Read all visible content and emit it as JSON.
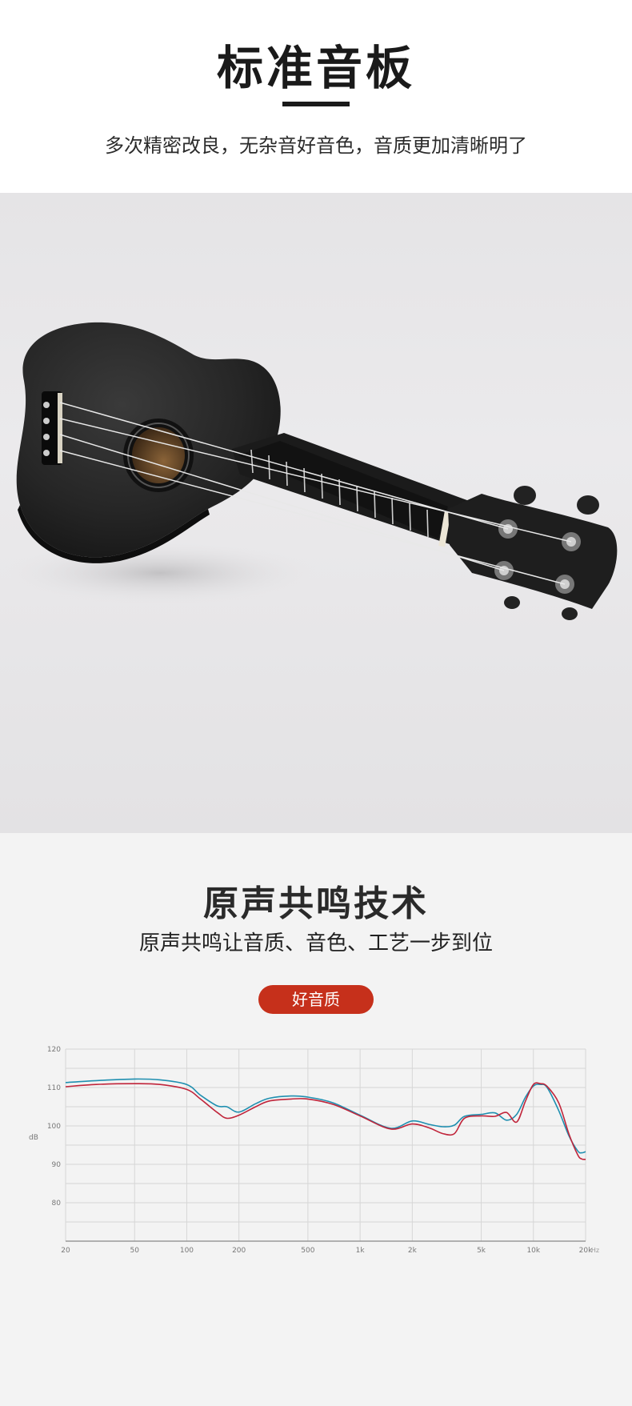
{
  "header": {
    "title": "标准音板",
    "subtitle": "多次精密改良，无杂音好音色，音质更加清晰明了"
  },
  "section2": {
    "title": "原声共鸣技术",
    "subtitle": "原声共鸣让音质、音色、工艺一步到位",
    "badge": "好音质"
  },
  "colors": {
    "accent": "#c6301b",
    "series_blue": "#1f8fb0",
    "series_red": "#c0243a",
    "grid": "#d6d6d6"
  },
  "chart_data": {
    "type": "line",
    "xscale": "log",
    "xlim": [
      20,
      20000
    ],
    "ylim": [
      70,
      120
    ],
    "grid": true,
    "xunit": "Hz",
    "ylabel": "dB",
    "y_ticks": [
      120,
      110,
      100,
      90,
      80
    ],
    "y_tick_labels": [
      "120",
      "110",
      "100",
      "90",
      "80"
    ],
    "x_ticks": [
      20,
      50,
      100,
      200,
      500,
      1000,
      2000,
      5000,
      10000,
      20000
    ],
    "x_tick_labels": [
      "20",
      "50",
      "100",
      "200",
      "500",
      "1k",
      "2k",
      "5k",
      "10k",
      "20k"
    ],
    "series": [
      {
        "points": [
          [
            20,
            111.3
          ],
          [
            30,
            111.8
          ],
          [
            50,
            112.2
          ],
          [
            70,
            112
          ],
          [
            100,
            110.8
          ],
          [
            120,
            108
          ],
          [
            150,
            105.2
          ],
          [
            170,
            105
          ],
          [
            200,
            103.6
          ],
          [
            250,
            105.8
          ],
          [
            300,
            107.2
          ],
          [
            400,
            107.8
          ],
          [
            500,
            107.5
          ],
          [
            700,
            106
          ],
          [
            1000,
            102.8
          ],
          [
            1500,
            99.4
          ],
          [
            2000,
            101.3
          ],
          [
            2500,
            100.4
          ],
          [
            3000,
            99.8
          ],
          [
            3500,
            100.2
          ],
          [
            4000,
            102.5
          ],
          [
            5000,
            103
          ],
          [
            6000,
            103.4
          ],
          [
            7000,
            101.5
          ],
          [
            8000,
            103
          ],
          [
            9000,
            107.5
          ],
          [
            10000,
            110.4
          ],
          [
            11000,
            110.8
          ],
          [
            12000,
            110
          ],
          [
            14000,
            104
          ],
          [
            16000,
            97.5
          ],
          [
            18000,
            93.5
          ],
          [
            19000,
            93
          ],
          [
            20000,
            93.3
          ]
        ]
      },
      {
        "points": [
          [
            20,
            110.2
          ],
          [
            30,
            110.8
          ],
          [
            50,
            111
          ],
          [
            70,
            110.8
          ],
          [
            100,
            109.5
          ],
          [
            120,
            107
          ],
          [
            150,
            103.5
          ],
          [
            170,
            102
          ],
          [
            200,
            102.8
          ],
          [
            250,
            105
          ],
          [
            300,
            106.5
          ],
          [
            400,
            107
          ],
          [
            500,
            107
          ],
          [
            700,
            105.6
          ],
          [
            1000,
            102.6
          ],
          [
            1500,
            99.2
          ],
          [
            2000,
            100.5
          ],
          [
            2500,
            99.5
          ],
          [
            3000,
            98
          ],
          [
            3500,
            98
          ],
          [
            4000,
            102
          ],
          [
            5000,
            102.6
          ],
          [
            6000,
            102.5
          ],
          [
            7000,
            103.5
          ],
          [
            8000,
            101
          ],
          [
            9000,
            106.5
          ],
          [
            10000,
            110.8
          ],
          [
            11000,
            111
          ],
          [
            12000,
            110.3
          ],
          [
            14000,
            106
          ],
          [
            16000,
            98
          ],
          [
            18000,
            92.5
          ],
          [
            19000,
            91.4
          ],
          [
            20000,
            91.3
          ]
        ]
      }
    ]
  }
}
